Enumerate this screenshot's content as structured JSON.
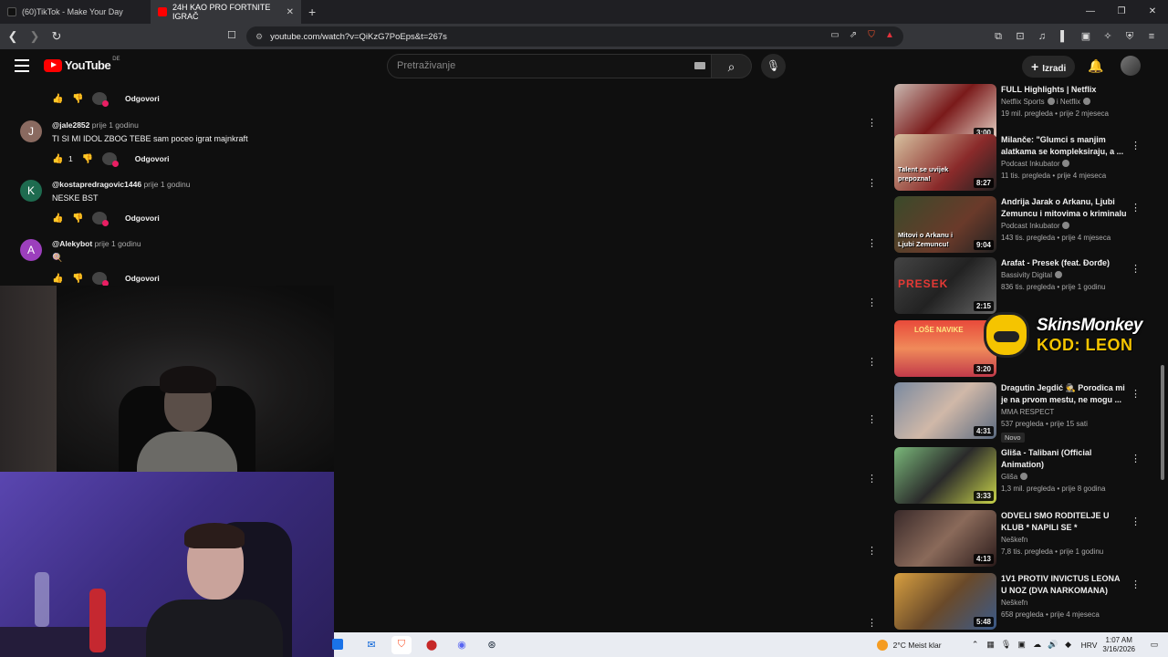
{
  "browser": {
    "tabs": [
      {
        "label": "(60)TikTok - Make Your Day",
        "active": false,
        "favicon_color": "#111111"
      },
      {
        "label": "24H KAO PRO FORTNITE IGRAČ",
        "active": true,
        "favicon_color": "#ff0000"
      }
    ],
    "url": "youtube.com/watch?v=QiKzG7PoEps&t=267s"
  },
  "youtube": {
    "logo_text": "YouTube",
    "country_code": "DE",
    "search_placeholder": "Pretraživanje",
    "create_label": "Izradi"
  },
  "comments": {
    "top_actions": {
      "reply": "Odgovori"
    },
    "items": [
      {
        "author": "@jale2852",
        "time": "prije 1 godinu",
        "text": "TI SI MI IDOL ZBOG TEBE sam poceo igrat majnkraft",
        "likes": "1",
        "reply": "Odgovori",
        "initial": "J",
        "avatar_color": "#8a6a60"
      },
      {
        "author": "@kostapredragovic1446",
        "time": "prije 1 godinu",
        "text": "NESKE BST",
        "likes": "",
        "reply": "Odgovori",
        "initial": "K",
        "avatar_color": "#1e6b4f"
      },
      {
        "author": "@Alekybot",
        "time": "prije 1 godinu",
        "text": "🍭",
        "likes": "",
        "reply": "Odgovori",
        "initial": "A",
        "avatar_color": "#9c3fbd"
      }
    ]
  },
  "recommendations": [
    {
      "title": "FULL Highlights | Netflix",
      "channel": "Netflix Sports",
      "channel_suffix": "i Netflix",
      "verified": true,
      "views": "19 mil. pregleda",
      "age": "prije 2 mjeseca",
      "duration": "3:00",
      "thumb": "linear-gradient(135deg,#c9b8b0,#7a1a1a 50%,#e6d2c6)",
      "badge": ""
    },
    {
      "title": "Milanče: \"Glumci s manjim alatkama se kompleksiraju, a ...",
      "channel": "Podcast Inkubator",
      "channel_suffix": "",
      "verified": true,
      "views": "11 tis. pregleda",
      "age": "prije 4 mjeseca",
      "duration": "8:27",
      "thumb": "linear-gradient(135deg,#d7c2a0,#8a2a2a 60%,#222)",
      "badge": "",
      "thumb_caption": "Talent se uvijek prepozna!"
    },
    {
      "title": "Andrija Jarak o Arkanu, Ljubi Zemuncu i mitovima o kriminalu",
      "channel": "Podcast Inkubator",
      "channel_suffix": "",
      "verified": true,
      "views": "143 tis. pregleda",
      "age": "prije 4 mjeseca",
      "duration": "9:04",
      "thumb": "linear-gradient(135deg,#3a4a2a,#6a3a2a 60%,#222)",
      "badge": "",
      "thumb_caption": "Mitovi o Arkanu i Ljubi Zemuncu!"
    },
    {
      "title": "Arafat - Presek (feat. Đorđe)",
      "channel": "Bassivity Digital",
      "channel_suffix": "",
      "verified": true,
      "views": "836 tis. pregleda",
      "age": "prije 1 godinu",
      "duration": "2:15",
      "thumb": "linear-gradient(135deg,#444,#222 50%,#666)",
      "badge": "",
      "thumb_caption": "PRESEK"
    },
    {
      "title": "Loše navike",
      "channel": "",
      "channel_suffix": "",
      "verified": false,
      "views": "",
      "age": "",
      "duration": "3:20",
      "thumb": "linear-gradient(180deg,#e84a3a,#f08a5a 50%,#c23a4a)",
      "badge": "",
      "thumb_caption": "LOŠE NAVIKE"
    },
    {
      "title": "Dragutin Jegdić 🕵 Porodica mi je na prvom mestu, ne mogu ...",
      "channel": "MMA RESPECT",
      "channel_suffix": "",
      "verified": false,
      "views": "537 pregleda",
      "age": "prije 15 sati",
      "duration": "4:31",
      "thumb": "linear-gradient(135deg,#7a8aa0,#d0b8a8 50%,#5a6a80)",
      "badge": "Novo"
    },
    {
      "title": "Gliša - Talibani (Official Animation)",
      "channel": "Gliša",
      "channel_suffix": "",
      "verified": true,
      "views": "1,3 mil. pregleda",
      "age": "prije 8 godina",
      "duration": "3:33",
      "thumb": "linear-gradient(135deg,#7ab87a,#2a2a2a 50%,#c9d44a)",
      "badge": ""
    },
    {
      "title": "ODVELI SMO RODITELJE U KLUB * NAPILI SE *",
      "channel": "Neškefn",
      "channel_suffix": "",
      "verified": false,
      "views": "7,8 tis. pregleda",
      "age": "prije 1 godinu",
      "duration": "4:13",
      "thumb": "linear-gradient(135deg,#3a2a2a,#8a6a5a 50%,#2a1a1a)",
      "badge": ""
    },
    {
      "title": "1V1 PROTIV INVICTUS LEONA U NOZ (DVA NARKOMANA)",
      "channel": "Neškefn",
      "channel_suffix": "",
      "verified": false,
      "views": "658 pregleda",
      "age": "prije 4 mjeseca",
      "duration": "5:48",
      "thumb": "linear-gradient(135deg,#d8a040,#6a4a2a 50%,#3a5a8a)",
      "badge": ""
    }
  ],
  "sponsor": {
    "line1": "SkinsMonkey",
    "line2": "KOD: LEON"
  },
  "taskbar": {
    "weather": "2°C  Meist klar",
    "language": "HRV",
    "time": "1:07 AM",
    "date": "3/16/2026"
  }
}
